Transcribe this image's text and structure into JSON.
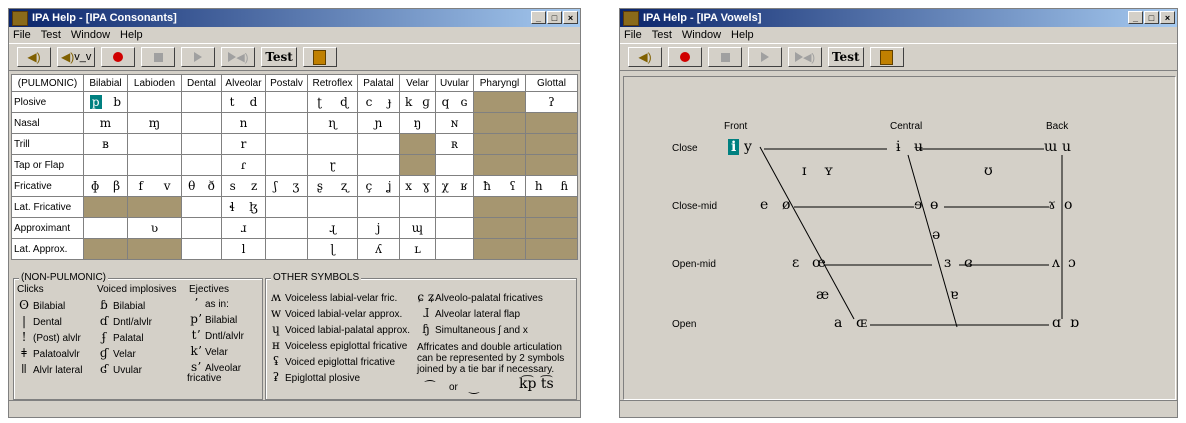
{
  "consonants_window": {
    "title": "IPA Help - [IPA Consonants]",
    "menu": [
      "File",
      "Test",
      "Window",
      "Help"
    ],
    "toolbar": {
      "voiced_label": "v_v",
      "test_label": "Test"
    },
    "columns": [
      "(PULMONIC)",
      "Bilabial",
      "Labioden",
      "Dental",
      "Alveolar",
      "Postalv",
      "Retroflex",
      "Palatal",
      "Velar",
      "Uvular",
      "Pharyngl",
      "Glottal"
    ],
    "rows": [
      {
        "label": "Plosive",
        "cells": [
          [
            "p",
            "b"
          ],
          [],
          [],
          [
            "t",
            "d"
          ],
          [],
          [
            "ʈ",
            "ɖ"
          ],
          [
            "c",
            "ɟ"
          ],
          [
            "k",
            "ɡ"
          ],
          [
            "q",
            "ɢ"
          ],
          [],
          [
            "ʔ"
          ]
        ]
      },
      {
        "label": "Nasal",
        "cells": [
          [
            "m"
          ],
          [
            "ɱ"
          ],
          [],
          [
            "n"
          ],
          [],
          [
            "ɳ"
          ],
          [
            "ɲ"
          ],
          [
            "ŋ"
          ],
          [
            "ɴ"
          ],
          [],
          []
        ]
      },
      {
        "label": "Trill",
        "cells": [
          [
            "ʙ"
          ],
          [],
          [],
          [
            "r"
          ],
          [],
          [],
          [],
          [],
          [
            "ʀ"
          ],
          [],
          []
        ]
      },
      {
        "label": "Tap or Flap",
        "cells": [
          [],
          [],
          [],
          [
            "ɾ"
          ],
          [],
          [
            "ɽ"
          ],
          [],
          [],
          [],
          [],
          []
        ]
      },
      {
        "label": "Fricative",
        "cells": [
          [
            "ɸ",
            "β"
          ],
          [
            "f",
            "v"
          ],
          [
            "θ",
            "ð"
          ],
          [
            "s",
            "z"
          ],
          [
            "ʃ",
            "ʒ"
          ],
          [
            "ʂ",
            "ʐ"
          ],
          [
            "ç",
            "ʝ"
          ],
          [
            "x",
            "ɣ"
          ],
          [
            "χ",
            "ʁ"
          ],
          [
            "ħ",
            "ʕ"
          ],
          [
            "h",
            "ɦ"
          ]
        ]
      },
      {
        "label": "Lat. Fricative",
        "cells": [
          [],
          [],
          [],
          [
            "ɬ",
            "ɮ"
          ],
          [],
          [],
          [],
          [],
          [],
          [],
          []
        ]
      },
      {
        "label": "Approximant",
        "cells": [
          [],
          [
            "ʋ"
          ],
          [],
          [
            "ɹ"
          ],
          [],
          [
            "ɻ"
          ],
          [
            "j"
          ],
          [
            "ɰ"
          ],
          [],
          [],
          []
        ]
      },
      {
        "label": "Lat. Approx.",
        "cells": [
          [],
          [],
          [],
          [
            "l"
          ],
          [],
          [
            "ɭ"
          ],
          [
            "ʎ"
          ],
          [
            "ʟ"
          ],
          [],
          [],
          []
        ]
      }
    ],
    "non_pulmonic": {
      "heading": "(NON-PULMONIC)",
      "clicks_heading": "Clicks",
      "implosives_heading": "Voiced implosives",
      "ejectives_heading": "Ejectives",
      "clicks": [
        [
          "ʘ",
          "Bilabial"
        ],
        [
          "|",
          "Dental"
        ],
        [
          "!",
          "(Post) alvlr"
        ],
        [
          "ǂ",
          "Palatoalvlr"
        ],
        [
          "ǁ",
          "Alvlr lateral"
        ]
      ],
      "implosives": [
        [
          "ɓ",
          "Bilabial"
        ],
        [
          "ɗ",
          "Dntl/alvlr"
        ],
        [
          "ʄ",
          "Palatal"
        ],
        [
          "ɠ",
          "Velar"
        ],
        [
          "ʛ",
          "Uvular"
        ]
      ],
      "ejectives": [
        [
          "ʼ",
          "as in:"
        ],
        [
          "pʼ",
          "Bilabial"
        ],
        [
          "tʼ",
          "Dntl/alvlr"
        ],
        [
          "kʼ",
          "Velar"
        ],
        [
          "sʼ",
          "Alveolar fricative"
        ]
      ]
    },
    "other_symbols": {
      "heading": "OTHER SYMBOLS",
      "items": [
        [
          "ʍ",
          "Voiceless labial-velar fric."
        ],
        [
          "w",
          "Voiced labial-velar approx."
        ],
        [
          "ɥ",
          "Voiced labial-palatal approx."
        ],
        [
          "ʜ",
          "Voiceless epiglottal fricative"
        ],
        [
          "ʢ",
          "Voiced epiglottal fricative"
        ],
        [
          "ʡ",
          "Epiglottal plosive"
        ]
      ],
      "right_items": [
        [
          "ɕ ʑ",
          "Alveolo-palatal fricatives"
        ],
        [
          "ɺ",
          "Alveolar lateral flap"
        ],
        [
          "ɧ",
          "Simultaneous ʃ and x"
        ]
      ],
      "note": "Affricates and double articulation can be represented by 2 symbols joined by a tie bar if necessary.",
      "tie_or": "or",
      "tie_examples": "k͡p t͡s"
    }
  },
  "vowels_window": {
    "title": "IPA Help - [IPA Vowels]",
    "menu": [
      "File",
      "Test",
      "Window",
      "Help"
    ],
    "toolbar": {
      "test_label": "Test"
    },
    "columns": [
      "Front",
      "Central",
      "Back"
    ],
    "rows": [
      "Close",
      "Close-mid",
      "Open-mid",
      "Open"
    ],
    "vowels": {
      "close": [
        "i",
        "y",
        "ɨ",
        "ʉ",
        "ɯ",
        "u"
      ],
      "near_close": [
        "ɪ",
        "ʏ",
        "ʊ"
      ],
      "close_mid": [
        "e",
        "ø",
        "ɘ",
        "ɵ",
        "ɤ",
        "o"
      ],
      "mid": [
        "ə"
      ],
      "open_mid": [
        "ɛ",
        "œ",
        "ɜ",
        "ɞ",
        "ʌ",
        "ɔ"
      ],
      "near_open": [
        "æ",
        "ɐ"
      ],
      "open": [
        "a",
        "ɶ",
        "ɑ",
        "ɒ"
      ]
    }
  }
}
